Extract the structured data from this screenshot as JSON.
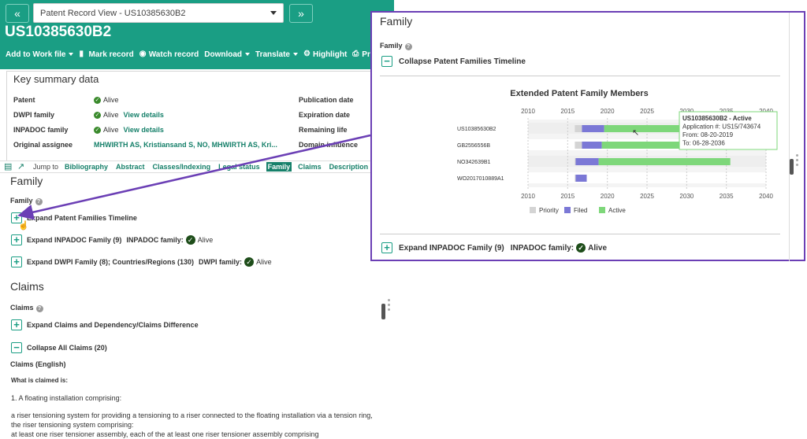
{
  "left": {
    "nav_prev": "«",
    "nav_next": "»",
    "view_select": "Patent Record View - US10385630B2",
    "patent_number": "US10385630B2",
    "toolbar": [
      {
        "label": "Add to Work file",
        "dropdown": true,
        "icon": ""
      },
      {
        "label": "Mark record",
        "dropdown": false,
        "icon": "bookmark-icon"
      },
      {
        "label": "Watch record",
        "dropdown": false,
        "icon": "eye-icon"
      },
      {
        "label": "Download",
        "dropdown": true,
        "icon": ""
      },
      {
        "label": "Translate",
        "dropdown": true,
        "icon": ""
      },
      {
        "label": "Highlight",
        "dropdown": false,
        "icon": "gear-icon"
      },
      {
        "label": "Print",
        "dropdown": false,
        "icon": "printer-icon"
      }
    ],
    "summary": {
      "title": "Key summary data",
      "rows": [
        {
          "label": "Patent",
          "value": "Alive",
          "link": ""
        },
        {
          "label": "DWPI family",
          "value": "Alive",
          "link": "View details"
        },
        {
          "label": "INPADOC family",
          "value": "Alive",
          "link": "View details"
        },
        {
          "label": "Original assignee",
          "value": "MHWIRTH AS, Kristiansand S, NO, MHWIRTH AS, Kri...",
          "link": ""
        }
      ],
      "right_labels": [
        "Publication date",
        "Expiration date",
        "Remaining life",
        "Domain influence"
      ]
    },
    "jumpbar": {
      "jump_to": "Jump to",
      "tabs": [
        "Bibliography",
        "Abstract",
        "Classes/Indexing",
        "Legal status",
        "Family",
        "Claims",
        "Description"
      ],
      "active": "Family"
    },
    "family": {
      "heading": "Family",
      "sub": "Family",
      "expand_timeline": "Expand Patent Families Timeline",
      "expand_inpadoc": "Expand INPADOC Family (9)",
      "inpadoc_label": "INPADOC family:",
      "inpadoc_status": "Alive",
      "expand_dwpi": "Expand DWPI Family (8); Countries/Regions (130)",
      "dwpi_label": "DWPI family:",
      "dwpi_status": "Alive"
    },
    "claims": {
      "heading": "Claims",
      "sub": "Claims",
      "expand_claims": "Expand Claims and Dependency/Claims Difference",
      "collapse_all": "Collapse All Claims (20)",
      "claims_english": "Claims (English)",
      "what_is_claimed": "What is claimed is:",
      "claim_1": "1. A floating installation comprising:",
      "claim_1_body": "a riser tensioning system for providing a tensioning to a riser connected to the floating installation via a tension ring, the riser tensioning system comprising:",
      "claim_1_more": "at least one riser tensioner assembly, each of the at least one riser tensioner assembly comprising"
    }
  },
  "right": {
    "title": "Family",
    "sub": "Family",
    "collapse_timeline": "Collapse Patent Families Timeline",
    "expand_inpadoc": "Expand INPADOC Family (9)",
    "inpadoc_label": "INPADOC family:",
    "inpadoc_status": "Alive"
  },
  "colors": {
    "teal": "#1a9e84",
    "purple_frame": "#6b3fb5",
    "priority": "#d4d4d4",
    "filed": "#7b78d6",
    "active": "#7ed77a"
  },
  "chart_data": {
    "type": "bar",
    "title": "Extended Patent Family Members",
    "orientation": "horizontal-timeline",
    "xlim": [
      2010,
      2040
    ],
    "xticks": [
      2010,
      2015,
      2020,
      2025,
      2030,
      2035,
      2040
    ],
    "categories": [
      "US10385630B2",
      "GB2556556B",
      "NO342639B1",
      "WO2017010889A1"
    ],
    "series": [
      {
        "name": "Priority",
        "segments": [
          [
            2015.9,
            2016.8
          ],
          [
            2015.9,
            2016.8
          ],
          [
            2015.9,
            2016.0
          ],
          [
            2015.9,
            2016.0
          ]
        ]
      },
      {
        "name": "Filed",
        "segments": [
          [
            2016.8,
            2019.6
          ],
          [
            2016.8,
            2019.3
          ],
          [
            2016.0,
            2018.9
          ],
          [
            2016.0,
            2017.4
          ]
        ]
      },
      {
        "name": "Active",
        "segments": [
          [
            2019.6,
            2036.5
          ],
          [
            2019.3,
            2036.5
          ],
          [
            2018.9,
            2035.5
          ],
          null
        ]
      }
    ],
    "legend": [
      "Priority",
      "Filed",
      "Active"
    ],
    "legend_position": "bottom",
    "tooltip": {
      "title": "US10385630B2 - Active",
      "application_label": "Application #:",
      "application": "US15/743674",
      "from_label": "From:",
      "from": "08-20-2019",
      "to_label": "To:",
      "to": "06-28-2036"
    }
  }
}
